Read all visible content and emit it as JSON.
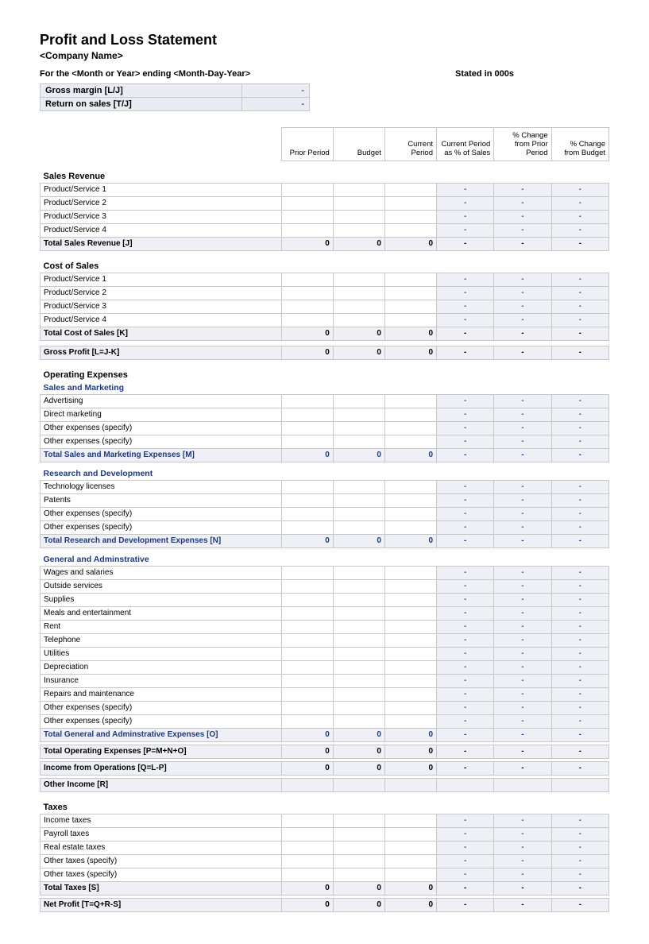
{
  "title": "Profit and Loss Statement",
  "company": "<Company Name>",
  "period": "For the <Month or Year> ending <Month-Day-Year>",
  "stated_in": "Stated in 000s",
  "metrics": {
    "gross_margin_label": "Gross margin  [L/J]",
    "gross_margin_value": "-",
    "return_on_sales_label": "Return on sales  [T/J]",
    "return_on_sales_value": "-"
  },
  "columns": {
    "desc": "",
    "prior": "Prior Period",
    "budget": "Budget",
    "current": "Current Period",
    "pct_sales": "Current Period as % of Sales",
    "pct_prior": "% Change from Prior Period",
    "pct_budget": "% Change from Budget"
  },
  "dash": "-",
  "zero": "0",
  "sections": {
    "sales_revenue": {
      "header": "Sales Revenue",
      "rows": [
        "Product/Service 1",
        "Product/Service 2",
        "Product/Service 3",
        "Product/Service 4"
      ],
      "total": "Total Sales Revenue  [J]"
    },
    "cost_of_sales": {
      "header": "Cost of Sales",
      "rows": [
        "Product/Service 1",
        "Product/Service 2",
        "Product/Service 3",
        "Product/Service 4"
      ],
      "total": "Total Cost of Sales  [K]"
    },
    "gross_profit": "Gross Profit  [L=J-K]",
    "operating_expenses": "Operating Expenses",
    "sales_marketing": {
      "header": "Sales and Marketing",
      "rows": [
        "Advertising",
        "Direct marketing",
        "Other expenses (specify)",
        "Other expenses (specify)"
      ],
      "total": "Total Sales and Marketing Expenses  [M]"
    },
    "rnd": {
      "header": "Research and Development",
      "rows": [
        "Technology licenses",
        "Patents",
        "Other expenses (specify)",
        "Other expenses (specify)"
      ],
      "total": "Total Research and Development Expenses  [N]"
    },
    "ga": {
      "header": "General and Adminstrative",
      "rows": [
        "Wages and salaries",
        "Outside services",
        "Supplies",
        "Meals and entertainment",
        "Rent",
        "Telephone",
        "Utilities",
        "Depreciation",
        "Insurance",
        "Repairs and maintenance",
        "Other expenses (specify)",
        "Other expenses (specify)"
      ],
      "total": "Total General and Adminstrative Expenses  [O]"
    },
    "total_operating": "Total Operating Expenses  [P=M+N+O]",
    "income_from_ops": "Income from Operations  [Q=L-P]",
    "other_income": "Other Income  [R]",
    "taxes": {
      "header": "Taxes",
      "rows": [
        "Income taxes",
        "Payroll taxes",
        "Real estate taxes",
        "Other taxes (specify)",
        "Other taxes (specify)"
      ],
      "total": "Total Taxes  [S]"
    },
    "net_profit": "Net Profit  [T=Q+R-S]"
  }
}
